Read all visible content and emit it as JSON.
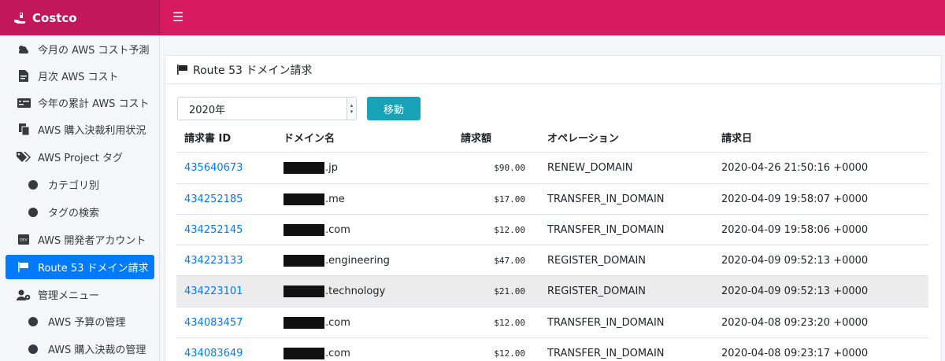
{
  "app": {
    "name": "Costco",
    "menu_icon": "hamburger-icon"
  },
  "sidebar": {
    "items": [
      {
        "label": "今月の AWS コスト予測",
        "icon": "cloud-weather-icon"
      },
      {
        "label": "月次 AWS コスト",
        "icon": "file-invoice-icon"
      },
      {
        "label": "今年の累計 AWS コスト",
        "icon": "money-check-icon"
      },
      {
        "label": "AWS 購入決裁利用状況",
        "icon": "copy-icon"
      },
      {
        "label": "AWS Project タグ",
        "icon": "tags-icon"
      },
      {
        "label": "カテゴリ別",
        "icon": "circle-icon"
      },
      {
        "label": "タグの検索",
        "icon": "circle-icon"
      },
      {
        "label": "AWS 開発者アカウント",
        "icon": "dev-icon"
      },
      {
        "label": "Route 53 ドメイン請求",
        "icon": "flag-icon",
        "active": true
      },
      {
        "label": "管理メニュー",
        "icon": "users-cog-icon"
      },
      {
        "label": "AWS 予算の管理",
        "icon": "circle-icon"
      },
      {
        "label": "AWS 購入決裁の管理",
        "icon": "circle-icon"
      }
    ]
  },
  "card": {
    "title": "Route 53 ドメイン請求",
    "icon": "flag-icon"
  },
  "filter": {
    "year_selected": "2020年",
    "submit_label": "移動"
  },
  "table": {
    "headers": {
      "id": "請求書 ID",
      "domain": "ドメイン名",
      "amount": "請求額",
      "operation": "オペレーション",
      "date": "請求日"
    },
    "rows": [
      {
        "id": "435640673",
        "domain_suffix": ".jp",
        "amount": "$90.00",
        "operation": "RENEW_DOMAIN",
        "date": "2020-04-26 21:50:16 +0000"
      },
      {
        "id": "434252185",
        "domain_suffix": ".me",
        "amount": "$17.00",
        "operation": "TRANSFER_IN_DOMAIN",
        "date": "2020-04-09 19:58:07 +0000"
      },
      {
        "id": "434252145",
        "domain_suffix": ".com",
        "amount": "$12.00",
        "operation": "TRANSFER_IN_DOMAIN",
        "date": "2020-04-09 19:58:06 +0000"
      },
      {
        "id": "434223133",
        "domain_suffix": ".engineering",
        "amount": "$47.00",
        "operation": "REGISTER_DOMAIN",
        "date": "2020-04-09 09:52:13 +0000"
      },
      {
        "id": "434223101",
        "domain_suffix": ".technology",
        "amount": "$21.00",
        "operation": "REGISTER_DOMAIN",
        "date": "2020-04-09 09:52:13 +0000"
      },
      {
        "id": "434083457",
        "domain_suffix": ".com",
        "amount": "$12.00",
        "operation": "TRANSFER_IN_DOMAIN",
        "date": "2020-04-08 09:23:20 +0000"
      },
      {
        "id": "434083649",
        "domain_suffix": ".com",
        "amount": "$12.00",
        "operation": "TRANSFER_IN_DOMAIN",
        "date": "2020-04-08 09:23:17 +0000"
      }
    ]
  },
  "colors": {
    "header": "#d81b60",
    "brand_bg": "#c2185b",
    "active": "#007bff",
    "button": "#17a2b8",
    "link": "#007bff"
  }
}
